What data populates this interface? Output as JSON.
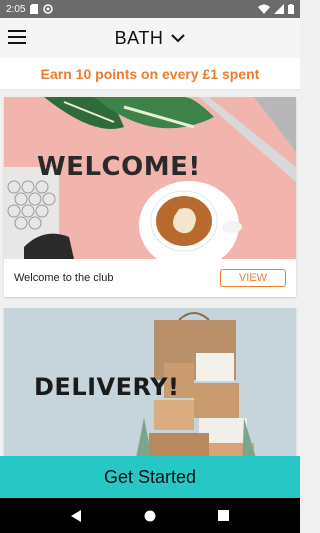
{
  "status_bar": {
    "time": "2:05",
    "icons": [
      "sd-card-icon",
      "sync-icon",
      "wifi-icon",
      "signal-icon",
      "battery-icon"
    ]
  },
  "app_bar": {
    "location": "BATH",
    "menu_icon": "hamburger-menu-icon",
    "dropdown_icon": "chevron-down-icon"
  },
  "promo": {
    "text": "Earn 10 points on every £1 spent"
  },
  "cards": [
    {
      "hero_text": "WELCOME!",
      "title": "Welcome to the club",
      "button": "VIEW"
    },
    {
      "hero_text": "DELIVERY!"
    }
  ],
  "cta": {
    "label": "Get Started"
  },
  "nav_bar": {
    "icons": [
      "back-icon",
      "home-icon",
      "recents-icon"
    ]
  },
  "colors": {
    "accent": "#ee7b2a",
    "cta": "#27c7c6",
    "status_bar": "#6b6b6b"
  }
}
